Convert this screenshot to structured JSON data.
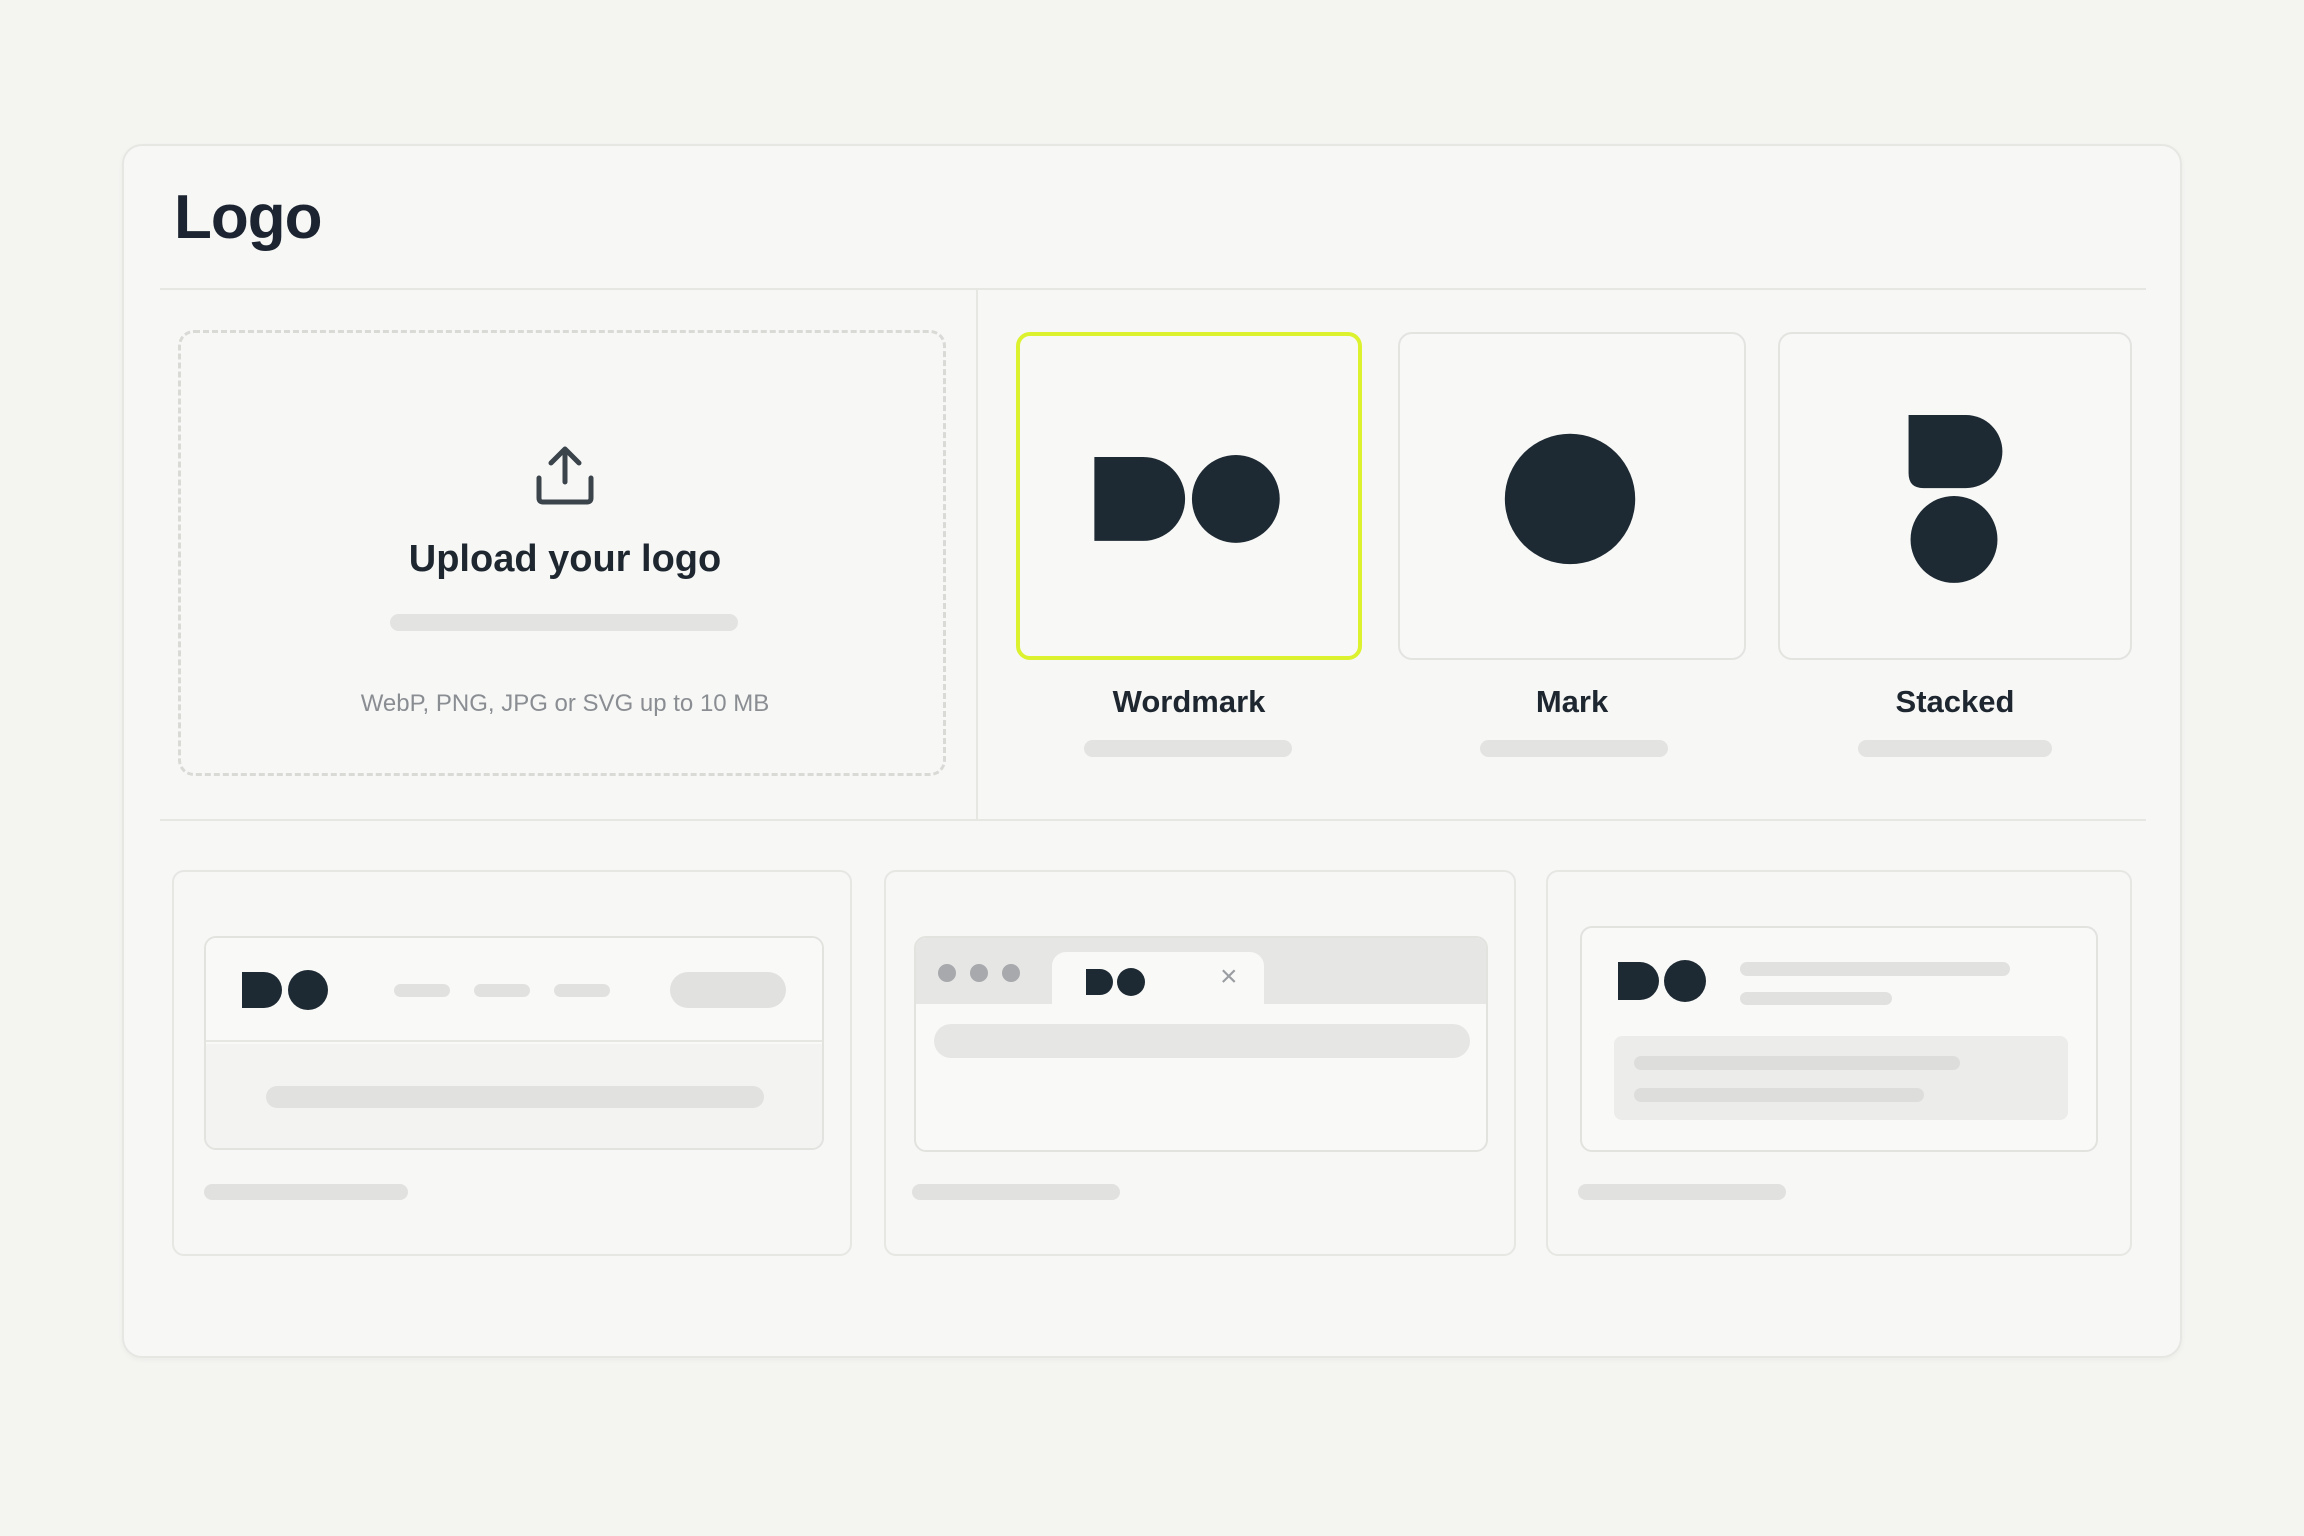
{
  "page": {
    "title": "Logo"
  },
  "upload": {
    "title": "Upload your logo",
    "hint": "WebP, PNG, JPG or SVG up to 10 MB",
    "icon": "upload-icon"
  },
  "variants": [
    {
      "label": "Wordmark",
      "selected": true,
      "icon": "wordmark-logo"
    },
    {
      "label": "Mark",
      "selected": false,
      "icon": "mark-logo"
    },
    {
      "label": "Stacked",
      "selected": false,
      "icon": "stacked-logo"
    }
  ],
  "previews": [
    {
      "kind": "website-header",
      "icon": "wordmark-logo"
    },
    {
      "kind": "browser-tab",
      "icon": "wordmark-logo",
      "close_glyph": "×"
    },
    {
      "kind": "email-card",
      "icon": "wordmark-logo"
    }
  ],
  "colors": {
    "accent": "#dcf22e",
    "logo": "#1e2a33",
    "placeholder": "#e3e3e1"
  }
}
